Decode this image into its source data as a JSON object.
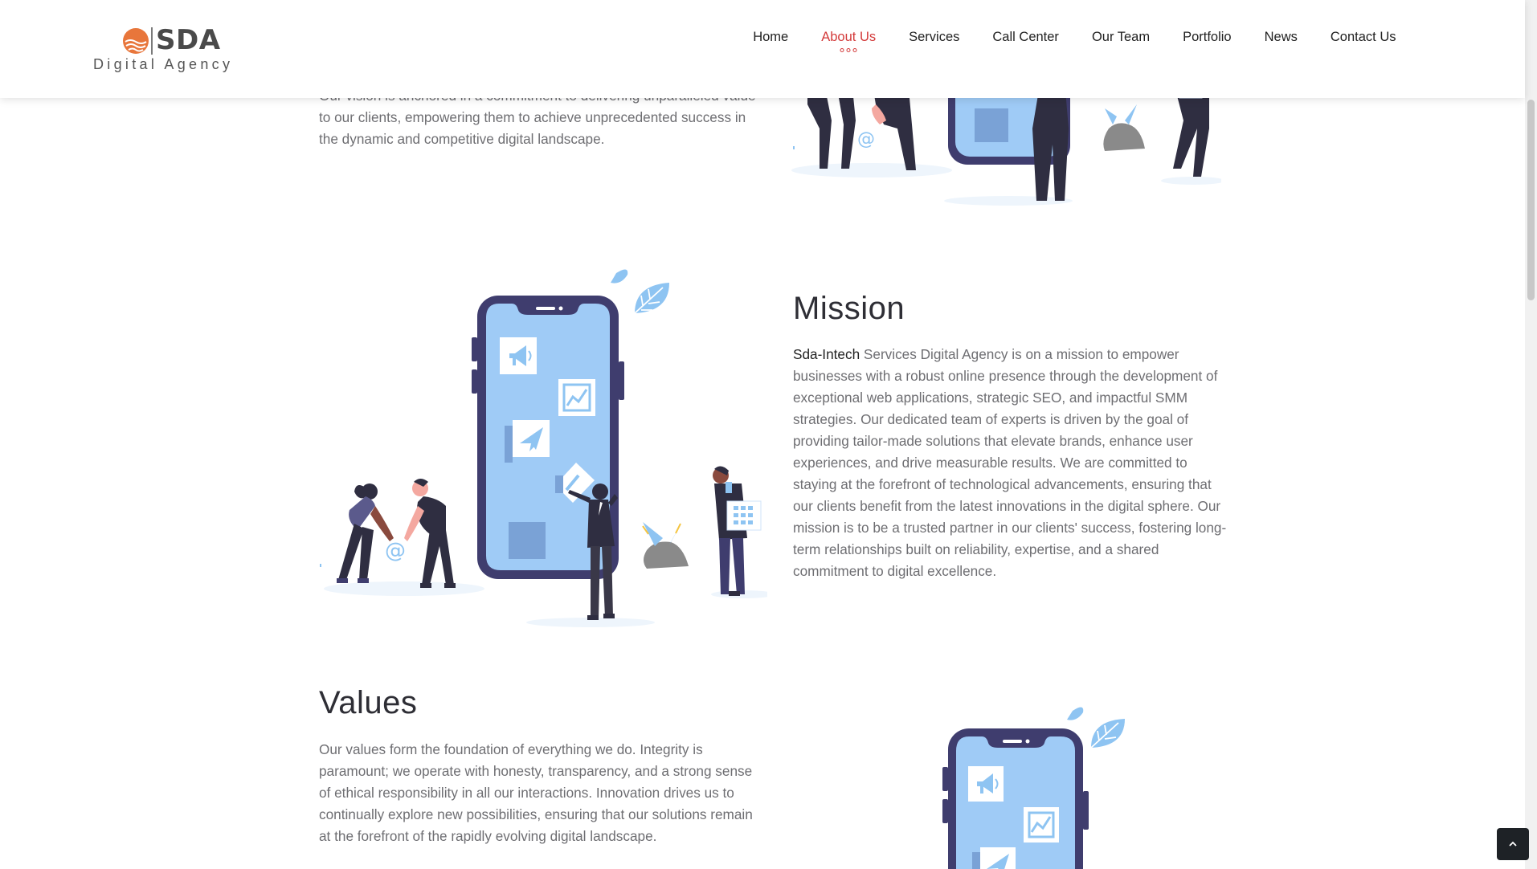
{
  "header": {
    "logo": {
      "brand": "SDA",
      "tagline": "Digital Agency",
      "brand_color": "#4a4a4a",
      "sun_color": "#e8763b"
    },
    "nav": [
      {
        "label": "Home",
        "active": false
      },
      {
        "label": "About Us",
        "active": true
      },
      {
        "label": "Services",
        "active": false
      },
      {
        "label": "Call Center",
        "active": false
      },
      {
        "label": "Our Team",
        "active": false
      },
      {
        "label": "Portfolio",
        "active": false
      },
      {
        "label": "News",
        "active": false
      },
      {
        "label": "Contact Us",
        "active": false
      }
    ],
    "active_color": "#d33a3a"
  },
  "vision": {
    "text_clipped": "Our vision is anchored in a commitment to delivering unparalleled value",
    "text": "to our clients, empowering them to achieve unprecedented success in the dynamic and competitive digital landscape."
  },
  "mission": {
    "title": "Mission",
    "lead": "Sda-Intech",
    "text": " Services Digital Agency is on a mission to empower businesses with a robust online presence through the development of exceptional web applications, strategic SEO, and impactful SMM strategies. Our dedicated team of experts is driven by the goal of providing tailor-made solutions that elevate brands, enhance user experiences, and drive measurable results. We are committed to staying at the forefront of technological advancements, ensuring that our clients benefit from the latest innovations in the digital sphere. Our mission is to be a trusted partner in our clients' success, fostering long-term relationships built on reliability, expertise, and a shared commitment to digital excellence."
  },
  "values": {
    "title": "Values",
    "text": "Our values form the foundation of everything we do. Integrity is paramount; we operate with honesty, transparency, and a strong sense of ethical responsibility in all our interactions. Innovation drives us to continually explore new possibilities, ensuring that our solutions remain at the forefront of the rapidly evolving digital landscape."
  },
  "icons": {
    "scroll_top": "chevron-up-icon",
    "illustration": "team-phone-illustration"
  },
  "colors": {
    "phone_body": "#3f3d6e",
    "phone_screen": "#9fcbf6",
    "leaf": "#8ec4f2"
  }
}
